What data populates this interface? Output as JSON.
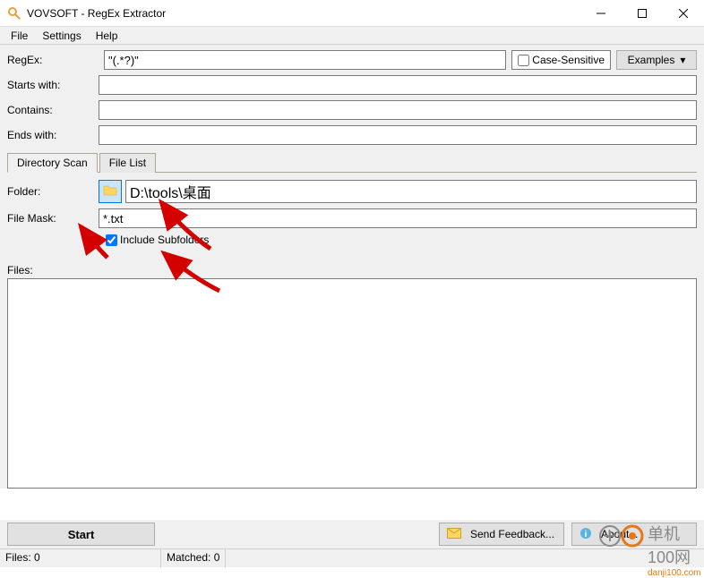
{
  "window": {
    "title": "VOVSOFT - RegEx Extractor"
  },
  "menu": {
    "file": "File",
    "settings": "Settings",
    "help": "Help"
  },
  "form": {
    "regex_label": "RegEx:",
    "regex_value": "\"(.*?)\"",
    "case_sensitive_label": "Case-Sensitive",
    "examples_label": "Examples",
    "starts_label": "Starts with:",
    "starts_value": "",
    "contains_label": "Contains:",
    "contains_value": "",
    "ends_label": "Ends with:",
    "ends_value": ""
  },
  "tabs": {
    "dir_scan": "Directory Scan",
    "file_list": "File List"
  },
  "dir": {
    "folder_label": "Folder:",
    "folder_value": "D:\\tools\\桌面",
    "mask_label": "File Mask:",
    "mask_value": "*.txt",
    "subfolders_label": "Include Subfolders"
  },
  "files": {
    "label": "Files:"
  },
  "bottom": {
    "start": "Start",
    "feedback": "Send Feedback...",
    "about": "About..."
  },
  "status": {
    "files": "Files: 0",
    "matched": "Matched: 0"
  },
  "watermark": {
    "text": "单机100网",
    "url": "danji100.com"
  }
}
